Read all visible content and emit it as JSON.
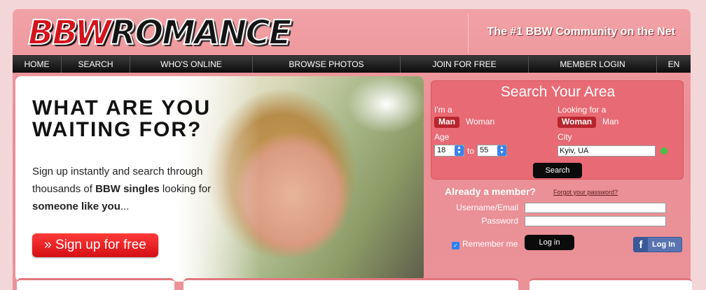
{
  "header": {
    "logo_part1": "BBW",
    "logo_part2": "ROMANCE",
    "tagline": "The #1 BBW Community on the Net"
  },
  "nav": {
    "items": [
      "HOME",
      "SEARCH",
      "WHO'S ONLINE",
      "BROWSE PHOTOS",
      "JOIN FOR FREE",
      "MEMBER LOGIN",
      "EN"
    ]
  },
  "hero": {
    "headline_line1": "WHAT ARE YOU",
    "headline_line2": "WAITING FOR?",
    "intro_part1": "Sign up instantly and search through thousands of ",
    "intro_bold1": "BBW singles",
    "intro_part2": " looking for ",
    "intro_bold2": "someone like you",
    "intro_part3": "...",
    "signup_label": "» Sign up for free"
  },
  "search": {
    "title": "Search Your Area",
    "im_a_label": "I'm a",
    "im_a_options": [
      "Man",
      "Woman"
    ],
    "im_a_selected": "Man",
    "looking_for_label": "Looking for a",
    "looking_for_options": [
      "Woman",
      "Man"
    ],
    "looking_for_selected": "Woman",
    "age_label": "Age",
    "age_from": "18",
    "age_to_label": "to",
    "age_to": "55",
    "city_label": "City",
    "city_value": "Kyiv, UA",
    "search_button": "Search"
  },
  "login": {
    "member_title": "Already a member?",
    "forgot_link": "Forgot your password?",
    "username_label": "Username/Email",
    "password_label": "Password",
    "remember_label": "Remember me",
    "remember_checked": true,
    "login_button": "Log in",
    "facebook_button": "Log In",
    "facebook_icon": "facebook-icon"
  },
  "colors": {
    "frame_pink": "#ea8e95",
    "search_box": "#e86a74",
    "nav_black": "#0c0c0c",
    "signup_red": "#d40f14",
    "facebook_blue": "#3b5998"
  }
}
